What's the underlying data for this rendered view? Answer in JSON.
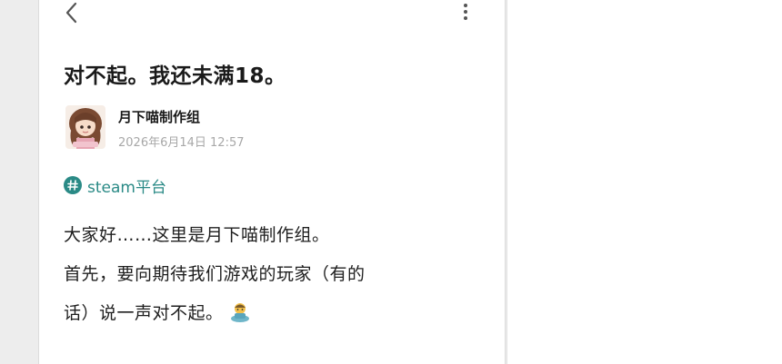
{
  "post": {
    "title": "对不起。我还未满18。",
    "author": "月下喵制作组",
    "date": "2026年6月14日 12:57",
    "tag": "steam平台",
    "body_lines": [
      "大家好……这里是月下喵制作组。",
      "首先，要向期待我们游戏的玩家（有的",
      "话）说一声对不起。"
    ]
  },
  "icons": {
    "back": "chevron-left-icon",
    "more": "more-vertical-icon",
    "tag": "hashtag-icon",
    "emoji": "person-bowing-emoji"
  },
  "colors": {
    "tag": "#2a8a86",
    "title": "#1a1a1a",
    "date": "#a8a8a8",
    "background": "#ededed"
  }
}
